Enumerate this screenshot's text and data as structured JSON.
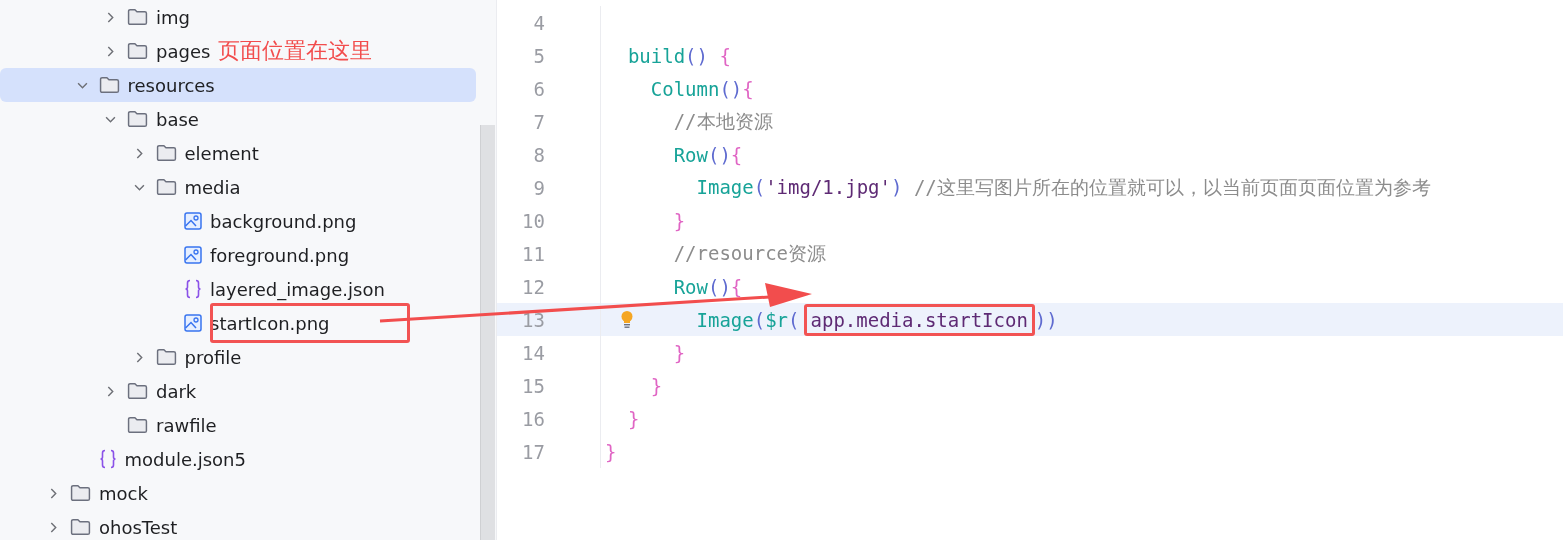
{
  "tree": {
    "items": [
      {
        "kind": "offscreen",
        "children": [
          {
            "kind": "offscreen",
            "children": [
              {
                "kind": "folder",
                "name": "img",
                "expanded": false,
                "selected": false
              },
              {
                "kind": "folder",
                "name": "pages",
                "expanded": false,
                "selected": false,
                "note": "页面位置在这里"
              }
            ]
          },
          {
            "kind": "folder",
            "name": "resources",
            "expanded": true,
            "selected": true,
            "children": [
              {
                "kind": "folder",
                "name": "base",
                "expanded": true,
                "selected": false,
                "children": [
                  {
                    "kind": "folder",
                    "name": "element",
                    "expanded": false,
                    "selected": false
                  },
                  {
                    "kind": "folder",
                    "name": "media",
                    "expanded": true,
                    "selected": false,
                    "children": [
                      {
                        "kind": "image",
                        "name": "background.png",
                        "selected": false
                      },
                      {
                        "kind": "image",
                        "name": "foreground.png",
                        "selected": false
                      },
                      {
                        "kind": "json",
                        "name": "layered_image.json",
                        "selected": false
                      },
                      {
                        "kind": "image",
                        "name": "startIcon.png",
                        "selected": false,
                        "boxed": true
                      }
                    ]
                  },
                  {
                    "kind": "folder",
                    "name": "profile",
                    "expanded": false,
                    "selected": false
                  }
                ]
              },
              {
                "kind": "folder",
                "name": "dark",
                "expanded": false,
                "selected": false
              },
              {
                "kind": "leaf-folder",
                "name": "rawfile",
                "selected": false
              }
            ]
          },
          {
            "kind": "json",
            "name": "module.json5",
            "selected": false
          }
        ]
      },
      {
        "kind": "folder",
        "name": "mock",
        "expanded": false,
        "selected": false
      },
      {
        "kind": "folder",
        "name": "ohosTest",
        "expanded": false,
        "selected": false
      }
    ]
  },
  "editor": {
    "lines": [
      {
        "number": "4",
        "current": false
      },
      {
        "number": "5",
        "current": false,
        "tokens": [
          {
            "kind": "fn",
            "text": "  build"
          },
          {
            "kind": "paren",
            "text": "()"
          },
          {
            "kind": "brace",
            "text": " {"
          }
        ]
      },
      {
        "number": "6",
        "current": false,
        "tokens": [
          {
            "kind": "fn",
            "text": "    Column"
          },
          {
            "kind": "paren",
            "text": "()"
          },
          {
            "kind": "brace",
            "text": "{"
          }
        ]
      },
      {
        "number": "7",
        "current": false,
        "tokens": [
          {
            "kind": "comment",
            "text": "      //本地资源"
          }
        ]
      },
      {
        "number": "8",
        "current": false,
        "tokens": [
          {
            "kind": "fn",
            "text": "      Row"
          },
          {
            "kind": "paren",
            "text": "()"
          },
          {
            "kind": "brace",
            "text": "{"
          }
        ]
      },
      {
        "number": "9",
        "current": false,
        "tokens": [
          {
            "kind": "fn",
            "text": "        Image"
          },
          {
            "kind": "paren",
            "text": "("
          },
          {
            "kind": "string",
            "text": "'img/1.jpg'"
          },
          {
            "kind": "paren",
            "text": ")"
          },
          {
            "kind": "comment",
            "text": " //这里写图片所在的位置就可以，以当前页面页面位置为参考"
          }
        ]
      },
      {
        "number": "10",
        "current": false,
        "tokens": [
          {
            "kind": "brace",
            "text": "      }"
          }
        ]
      },
      {
        "number": "11",
        "current": false,
        "tokens": [
          {
            "kind": "comment",
            "text": "      //resource资源"
          }
        ]
      },
      {
        "number": "12",
        "current": false,
        "tokens": [
          {
            "kind": "fn",
            "text": "      Row"
          },
          {
            "kind": "paren",
            "text": "()"
          },
          {
            "kind": "brace",
            "text": "{"
          }
        ]
      },
      {
        "number": "13",
        "current": true,
        "bulb": true,
        "tokens": [
          {
            "kind": "fn",
            "text": "        Image"
          },
          {
            "kind": "paren",
            "text": "("
          },
          {
            "kind": "fn",
            "text": "$r"
          },
          {
            "kind": "paren",
            "text": "("
          },
          {
            "kind": "boxed",
            "text": "app.media.startIcon"
          },
          {
            "kind": "paren",
            "text": "))"
          }
        ]
      },
      {
        "number": "14",
        "current": false,
        "tokens": [
          {
            "kind": "brace",
            "text": "      }"
          }
        ]
      },
      {
        "number": "15",
        "current": false,
        "tokens": [
          {
            "kind": "brace",
            "text": "    }"
          }
        ]
      },
      {
        "number": "16",
        "current": false,
        "tokens": [
          {
            "kind": "brace",
            "text": "  }"
          }
        ]
      },
      {
        "number": "17",
        "current": false,
        "tokens": [
          {
            "kind": "brace",
            "text": "}"
          }
        ]
      }
    ]
  }
}
